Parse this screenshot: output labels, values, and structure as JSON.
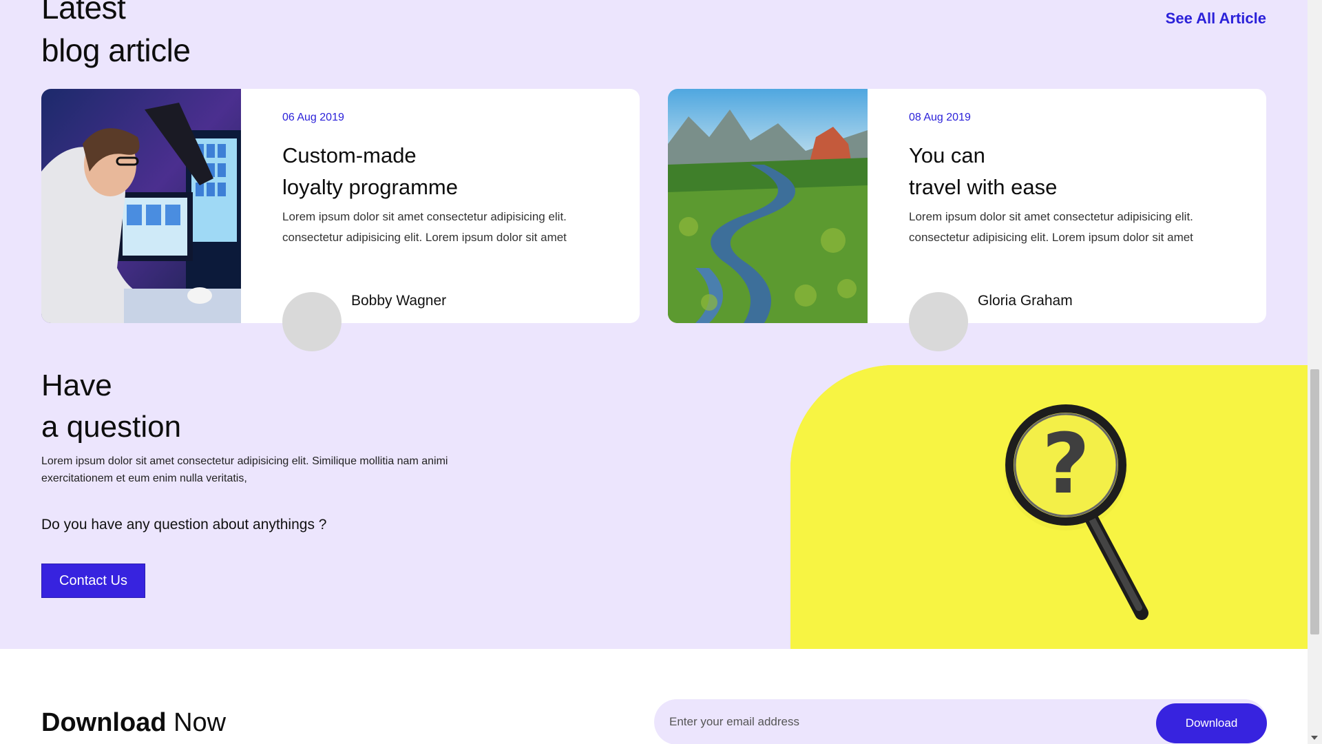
{
  "blog": {
    "title": "Latest\nblog article",
    "see_all": "See All Article",
    "cards": [
      {
        "date": "06 Aug 2019",
        "title": "Custom-made\nloyalty programme",
        "text": "Lorem ipsum dolor sit amet consectetur adipisicing elit. consectetur adipisicing elit. Lorem ipsum dolor sit amet",
        "author": "Bobby Wagner",
        "image_icon": "office-monitor-photo"
      },
      {
        "date": "08 Aug 2019",
        "title": "You can\ntravel with ease",
        "text": "Lorem ipsum dolor sit amet consectetur adipisicing elit. consectetur adipisicing elit. Lorem ipsum dolor sit amet",
        "author": "Gloria Graham",
        "image_icon": "river-landscape-photo"
      }
    ]
  },
  "question": {
    "title": "Have\na question",
    "text": "Lorem ipsum dolor sit amet consectetur adipisicing elit. Similique mollitia nam animi exercitationem et eum enim nulla veritatis,",
    "ask": "Do you have any question about anythings ?",
    "button": "Contact Us",
    "image_icon": "magnifier-question-photo"
  },
  "download": {
    "title_bold": "Download",
    "title_light": "Now",
    "email_placeholder": "Enter your email address",
    "button": "Download"
  },
  "colors": {
    "accent": "#3723df",
    "section_bg": "#ece5fd",
    "highlight": "#f5f23e"
  }
}
